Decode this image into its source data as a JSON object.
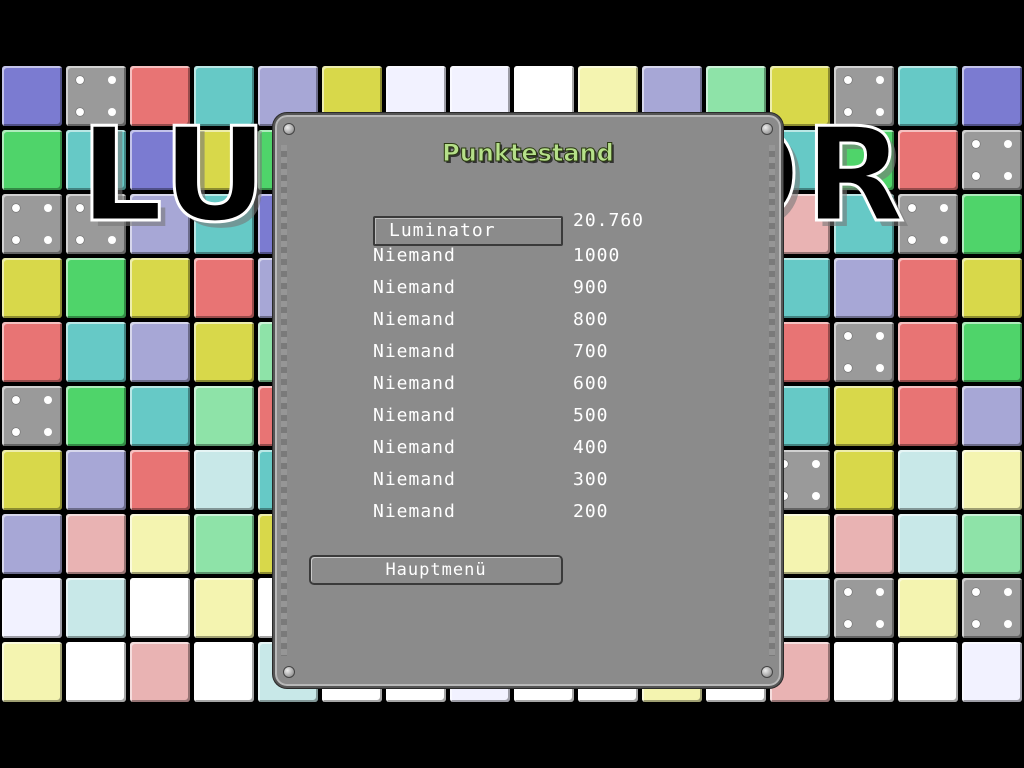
{
  "logo": {
    "left": "LU",
    "right": "OR"
  },
  "dialog": {
    "title": "Punktestand",
    "highscores": [
      {
        "name": "Luminator",
        "score": "20.760",
        "highlighted": true
      },
      {
        "name": "Niemand",
        "score": "1000"
      },
      {
        "name": "Niemand",
        "score": "900"
      },
      {
        "name": "Niemand",
        "score": "800"
      },
      {
        "name": "Niemand",
        "score": "700"
      },
      {
        "name": "Niemand",
        "score": "600"
      },
      {
        "name": "Niemand",
        "score": "500"
      },
      {
        "name": "Niemand",
        "score": "400"
      },
      {
        "name": "Niemand",
        "score": "300"
      },
      {
        "name": "Niemand",
        "score": "200"
      }
    ],
    "main_menu_label": "Hauptmenü"
  },
  "colors": {
    "background": "#000000",
    "panel": "#8b8b8b",
    "title_green": "#b6e08a",
    "tile_palette": [
      "#7b7bd1",
      "#4fd46a",
      "#e87474",
      "#66c9c6",
      "#d8d84a",
      "#a7a7d6",
      "#8ee3a8",
      "#f2f2ff",
      "#e9b3b3",
      "#c8e8e8",
      "#ffffff",
      "#f4f4b0"
    ]
  }
}
